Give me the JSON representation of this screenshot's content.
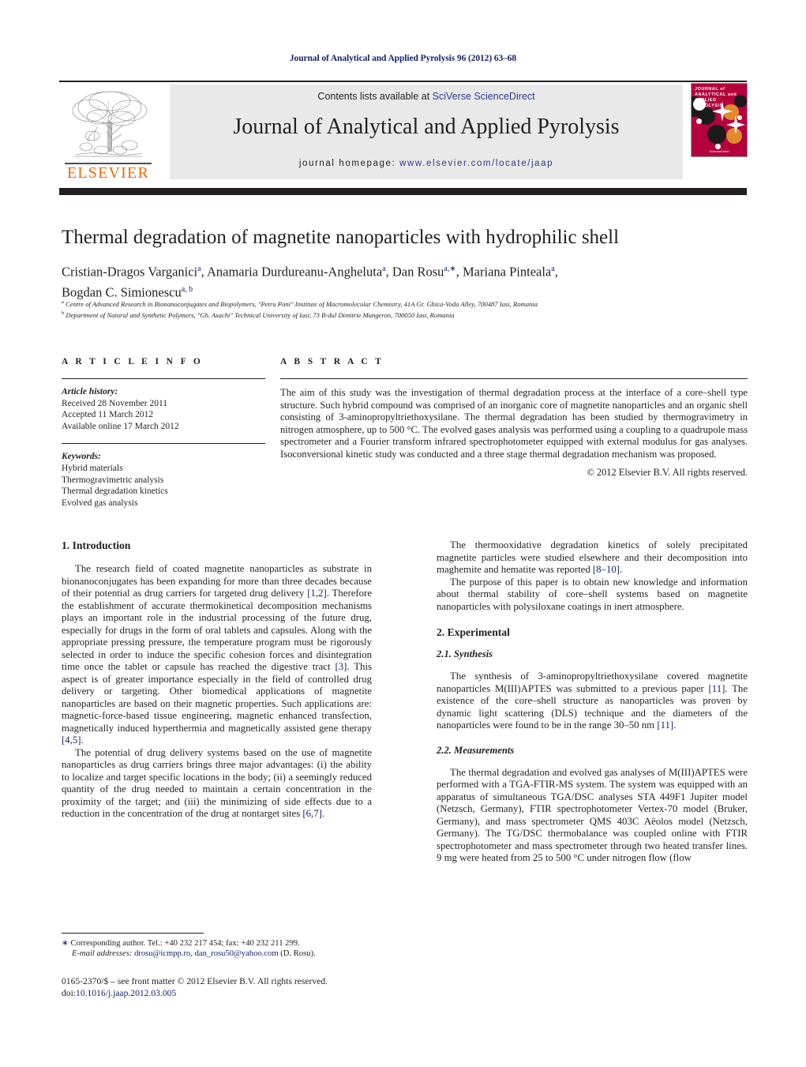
{
  "running_head": "Journal of Analytical and Applied Pyrolysis 96 (2012) 63–68",
  "header": {
    "contents_prefix": "Contents lists available at ",
    "contents_link": "SciVerse ScienceDirect",
    "journal_title": "Journal of Analytical and Applied Pyrolysis",
    "homepage_prefix": "journal homepage: ",
    "homepage_link": "www.elsevier.com/locate/jaap",
    "publisher_wordmark": "ELSEVIER",
    "cover_title_line1": "JOURNAL of",
    "cover_title_line2": "ANALYTICAL and",
    "cover_title_line3": "APPLIED PYROLYSIS",
    "cover_footer": "ScienceDirect",
    "accent_orange": "#eb6a0a",
    "accent_link_blue": "#2a3a90",
    "cover_red": "#b4003c",
    "bar_black": "#231f20"
  },
  "article": {
    "title": "Thermal degradation of magnetite nanoparticles with hydrophilic shell",
    "authors_line1": "Cristian-Dragos Varganici<sup>a</sup>, Anamaria Durdureanu-Angheluta<sup>a</sup>, Dan Rosu<sup>a,<span class=\"star-mark\">∗</span></sup>, Mariana Pinteala<sup>a</sup>,",
    "authors_line2": "Bogdan C. Simionescu<sup>a, b</sup>",
    "affiliation_a": "<sup>a</sup> Centre of Advanced Research in Bionanoconjugates and Biopolymers, \"Petru Poni\" Institute of Macromolecular Chemistry, 41A Gr. Ghica-Voda Alley, 700487 Iasi, Romania",
    "affiliation_b": "<sup>b</sup> Department of Natural and Synthetic Polymers, \"Gh. Asachi\" Technical University of Iasi, 73 B-dul Dimitrie Mangeron, 700050 Iasi, Romania"
  },
  "article_info": {
    "heading": "A R T I C L E    I N F O",
    "history_label": "Article history:",
    "history": [
      "Received 28 November 2011",
      "Accepted 11 March 2012",
      "Available online 17 March 2012"
    ],
    "keywords_label": "Keywords:",
    "keywords": [
      "Hybrid materials",
      "Thermogravimetric analysis",
      "Thermal degradation kinetics",
      "Evolved gas analysis"
    ]
  },
  "abstract": {
    "heading": "A B S T R A C T",
    "text": "The aim of this study was the investigation of thermal degradation process at the interface of a core–shell type structure. Such hybrid compound was comprised of an inorganic core of magnetite nanoparticles and an organic shell consisting of 3-aminopropyltriethoxysilane. The thermal degradation has been studied by thermogravimetry in nitrogen atmosphere, up to 500 °C. The evolved gases analysis was performed using a coupling to a quadrupole mass spectrometer and a Fourier transform infrared spectrophotometer equipped with external modulus for gas analyses. Isoconversional kinetic study was conducted and a three stage thermal degradation mechanism was proposed.",
    "copyright": "© 2012 Elsevier B.V. All rights reserved."
  },
  "body": {
    "left": {
      "section1_heading": "1.  Introduction",
      "p1": "The research field of coated magnetite nanoparticles as substrate in bionanoconjugates has been expanding for more than three decades because of their potential as drug carriers for targeted drug delivery <span class=\"ref\">[1,2]</span>. Therefore the establishment of accurate thermokinetical decomposition mechanisms plays an important role in the industrial processing of the future drug, especially for drugs in the form of oral tablets and capsules. Along with the appropriate pressing pressure, the temperature program must be rigorously selected in order to induce the specific cohesion forces and disintegration time once the tablet or capsule has reached the digestive tract <span class=\"ref\">[3]</span>. This aspect is of greater importance especially in the field of controlled drug delivery or targeting. Other biomedical applications of magnetite nanoparticles are based on their magnetic properties. Such applications are: magnetic-force-based tissue engineering, magnetic enhanced transfection, magnetically induced hyperthermia and magnetically assisted gene therapy <span class=\"ref\">[4,5]</span>.",
      "p2": "The potential of drug delivery systems based on the use of magnetite nanoparticles as drug carriers brings three major advantages: (i) the ability to localize and target specific locations in the body; (ii) a seemingly reduced quantity of the drug needed to maintain a certain concentration in the proximity of the target; and (iii) the minimizing of side effects due to a reduction in the concentration of the drug at nontarget sites <span class=\"ref\">[6,7]</span>."
    },
    "right": {
      "p1": "The thermooxidative degradation kinetics of solely precipitated magnetite particles were studied elsewhere and their decomposition into maghemite and hematite was reported <span class=\"ref\">[8–10]</span>.",
      "p2": "The purpose of this paper is to obtain new knowledge and information about thermal stability of core–shell systems based on magnetite nanoparticles with polysiloxane coatings in inert atmosphere.",
      "section2_heading": "2.  Experimental",
      "subsection21_heading": "2.1.  Synthesis",
      "p3": "The synthesis of 3-aminopropyltriethoxysilane covered magnetite nanoparticles M(III)APTES was submitted to a previous paper <span class=\"ref\">[11]</span>. The existence of the core–shell structure as nanoparticles was proven by dynamic light scattering (DLS) technique and the diameters of the nanoparticles were found to be in the range 30–50 nm <span class=\"ref\">[11]</span>.",
      "subsection22_heading": "2.2.  Measurements",
      "p4": "The thermal degradation and evolved gas analyses of M(III)APTES were performed with a TGA-FTIR-MS system. The system was equipped with an apparatus of simultaneous TGA/DSC analyses STA 449F1 Jupiter model (Netzsch, Germany), FTIR spectrophotometer Vertex-70 model (Bruker, Germany), and mass spectrometer QMS 403C Aëolos model (Netzsch, Germany). The TG/DSC thermobalance was coupled online with FTIR spectrophotometer and mass spectrometer through two heated transfer lines. 9 mg were heated from 25 to 500 °C under nitrogen flow (flow"
    }
  },
  "footer": {
    "corresponding": "<span class=\"star-mark\">∗</span> Corresponding author. Tel.: +40 232 217 454; fax: +40 232 211 299.",
    "email_label": "E-mail addresses:",
    "email1": "drosu@icmpp.ro",
    "email2": "dan_rosu50@yahoo.com",
    "email_suffix": "(D. Rosu).",
    "issn_line": "0165-2370/$ – see front matter © 2012 Elsevier B.V. All rights reserved.",
    "doi_label": "doi:",
    "doi_value": "10.1016/j.jaap.2012.03.005"
  }
}
